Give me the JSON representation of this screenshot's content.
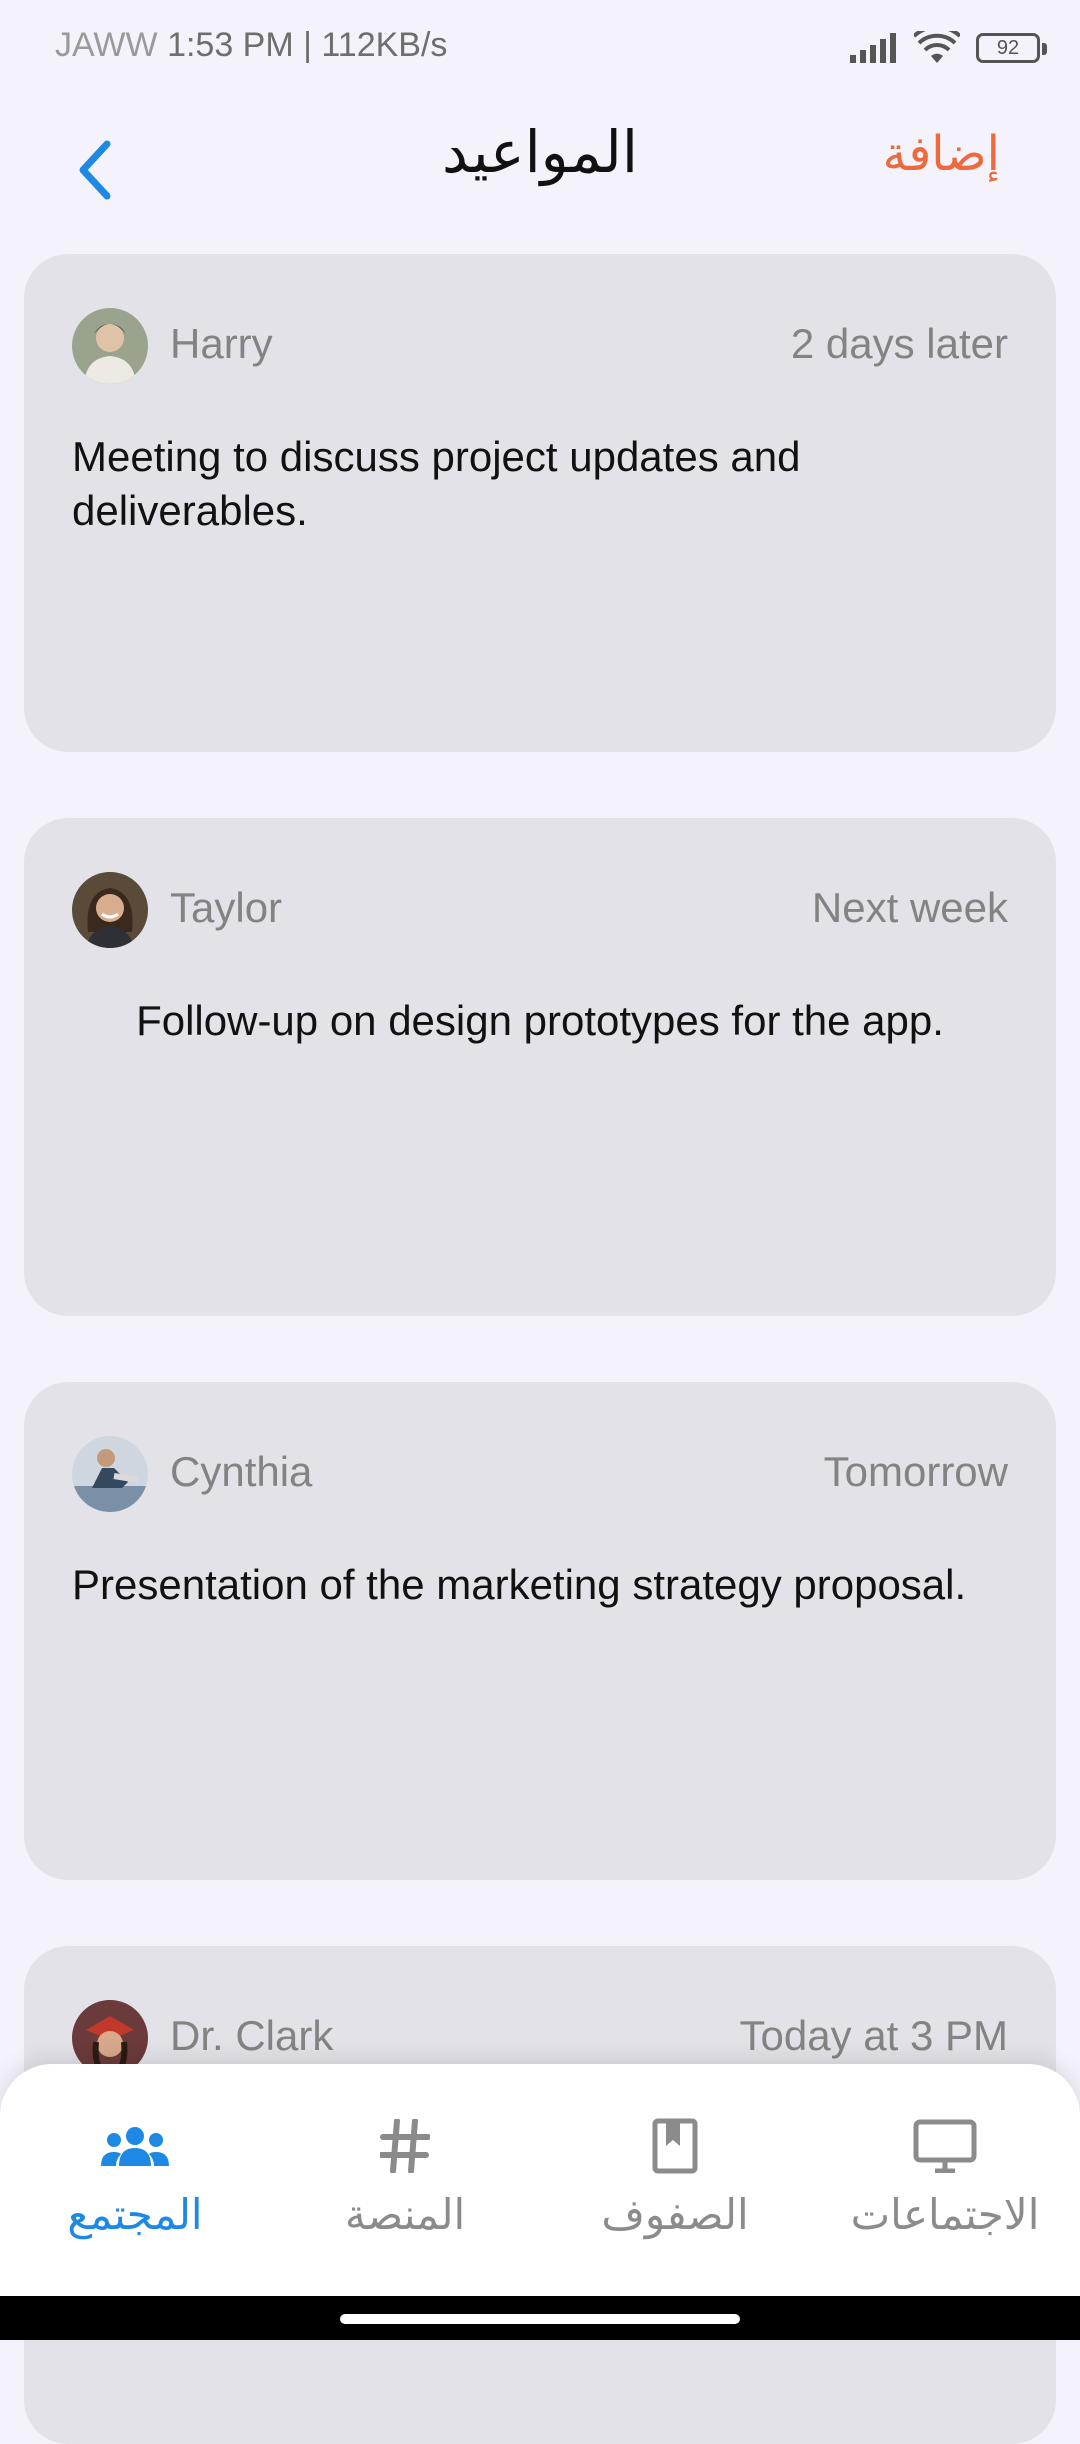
{
  "status_bar": {
    "carrier": "JAWW",
    "time_speed": "1:53 PM | 112KB/s",
    "battery": "92"
  },
  "header": {
    "title": "المواعيد",
    "add_label": "إضافة"
  },
  "appointments": [
    {
      "name": "Harry",
      "time": "2 days later",
      "description": "Meeting to discuss project updates and deliverables."
    },
    {
      "name": "Taylor",
      "time": "Next week",
      "description": "Follow-up on design prototypes for the app."
    },
    {
      "name": "Cynthia",
      "time": "Tomorrow",
      "description": "Presentation of the marketing strategy proposal."
    },
    {
      "name": "Dr. Clark",
      "time": "Today at 3 PM",
      "description": ""
    }
  ],
  "bottom_nav": [
    {
      "label": "المجتمع",
      "icon": "community-icon",
      "active": true
    },
    {
      "label": "المنصة",
      "icon": "hashtag-icon",
      "active": false
    },
    {
      "label": "الصفوف",
      "icon": "bookmark-icon",
      "active": false
    },
    {
      "label": "الاجتماعات",
      "icon": "monitor-icon",
      "active": false
    }
  ],
  "colors": {
    "accent": "#1E88E5",
    "add": "#EE6A3C",
    "card_bg": "#E3E2E8",
    "page_bg": "#F4F3FB"
  }
}
